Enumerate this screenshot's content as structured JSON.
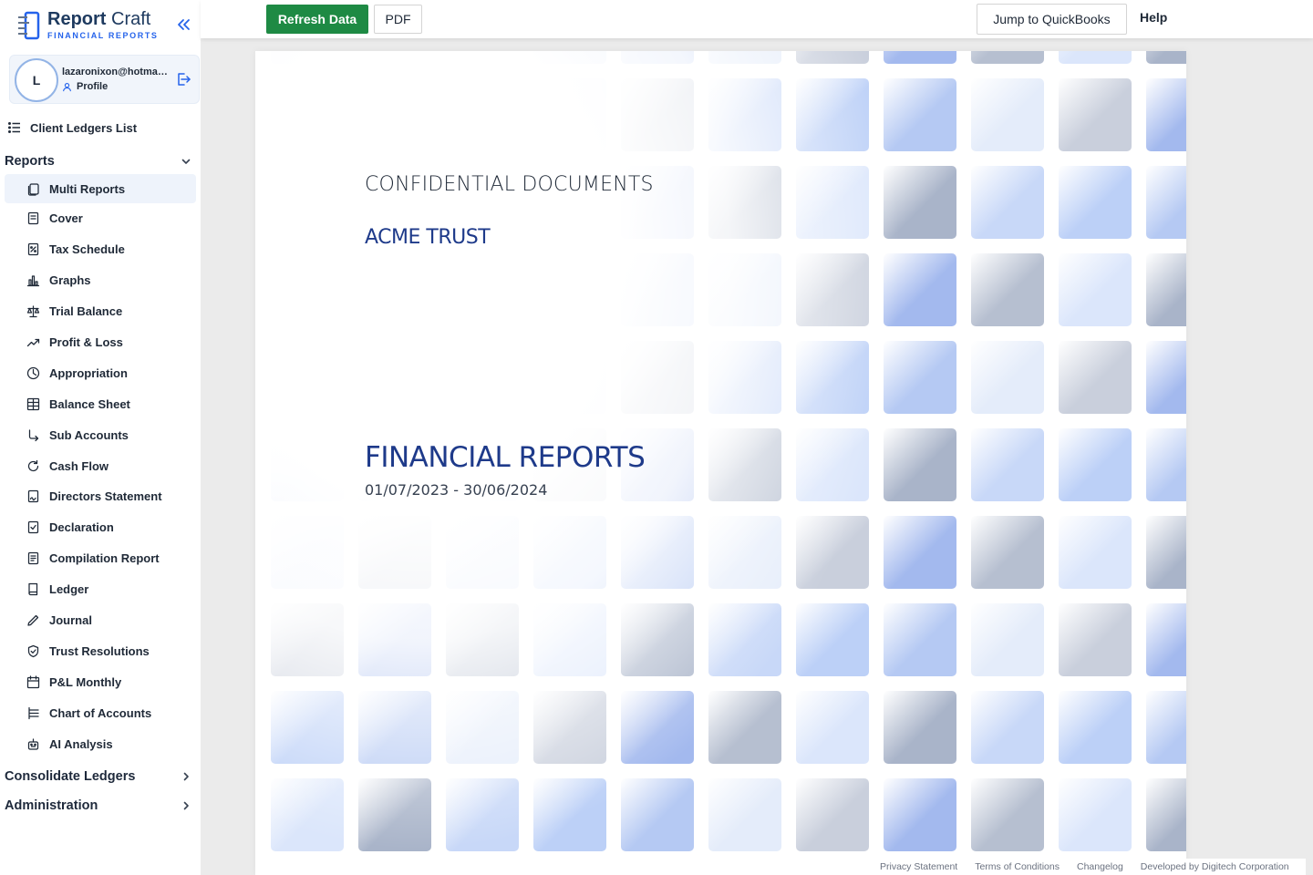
{
  "brand": {
    "name_bold": "Report",
    "name_light": "Craft",
    "subtitle": "FINANCIAL REPORTS"
  },
  "user": {
    "initial": "L",
    "email": "lazaronixon@hotmail.com",
    "profile_label": "Profile"
  },
  "nav": {
    "client_ledgers": "Client Ledgers List",
    "reports_label": "Reports",
    "reports_items": [
      {
        "label": "Multi Reports",
        "icon": "copy-icon",
        "active": true
      },
      {
        "label": "Cover",
        "icon": "document-icon"
      },
      {
        "label": "Tax Schedule",
        "icon": "percent-file-icon"
      },
      {
        "label": "Graphs",
        "icon": "bar-chart-icon"
      },
      {
        "label": "Trial Balance",
        "icon": "scale-icon"
      },
      {
        "label": "Profit & Loss",
        "icon": "trending-up-icon"
      },
      {
        "label": "Appropriation",
        "icon": "pie-clock-icon"
      },
      {
        "label": "Balance Sheet",
        "icon": "table-icon"
      },
      {
        "label": "Sub Accounts",
        "icon": "corner-down-right-icon"
      },
      {
        "label": "Cash Flow",
        "icon": "refresh-icon"
      },
      {
        "label": "Directors Statement",
        "icon": "signature-file-icon"
      },
      {
        "label": "Declaration",
        "icon": "check-file-icon"
      },
      {
        "label": "Compilation Report",
        "icon": "lines-file-icon"
      },
      {
        "label": "Ledger",
        "icon": "book-icon"
      },
      {
        "label": "Journal",
        "icon": "pencil-icon"
      },
      {
        "label": "Trust Resolutions",
        "icon": "shield-check-icon"
      },
      {
        "label": "P&L Monthly",
        "icon": "calendar-icon"
      },
      {
        "label": "Chart of Accounts",
        "icon": "list-tree-icon"
      },
      {
        "label": "AI Analysis",
        "icon": "robot-icon"
      }
    ],
    "consolidate_label": "Consolidate Ledgers",
    "administration_label": "Administration"
  },
  "toolbar": {
    "refresh_label": "Refresh Data",
    "pdf_label": "PDF",
    "quickbooks_label": "Jump to QuickBooks",
    "help_label": "Help"
  },
  "document": {
    "confidential": "CONFIDENTIAL DOCUMENTS",
    "entity": "ACME TRUST",
    "title": "FINANCIAL REPORTS",
    "period": "01/07/2023 - 30/06/2024"
  },
  "footer": {
    "links": [
      "Privacy Statement",
      "Terms of Conditions",
      "Changelog",
      "Developed by Digitech Corporation"
    ]
  },
  "colors": {
    "accent": "#2563eb",
    "refresh_button": "#1e8a44",
    "brand_navy": "#1e3a8a"
  }
}
